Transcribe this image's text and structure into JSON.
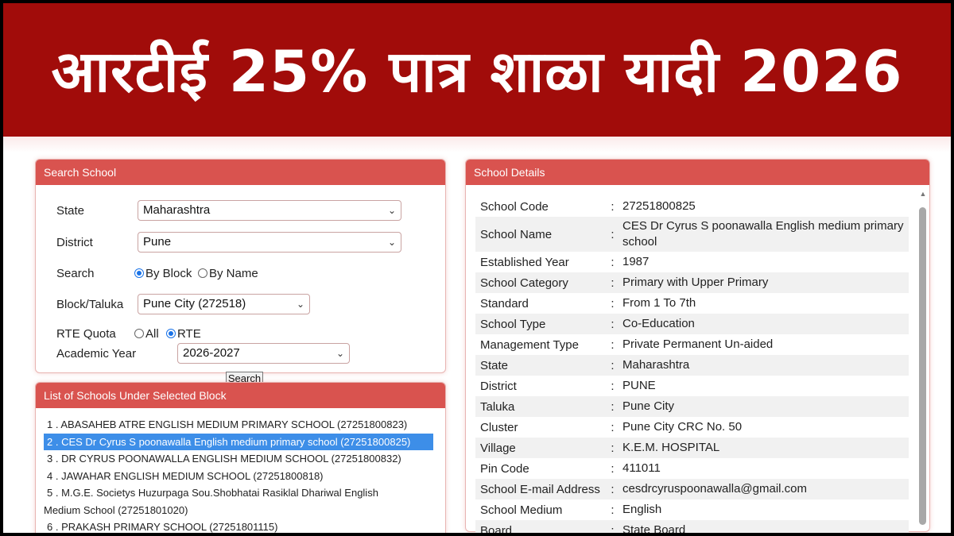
{
  "banner": {
    "title": "आरटीई 25% पात्र शाळा यादी 2026"
  },
  "search_panel": {
    "header": "Search School",
    "state_label": "State",
    "state_value": "Maharashtra",
    "district_label": "District",
    "district_value": "Pune",
    "search_label": "Search",
    "search_by_block": "By Block",
    "search_by_name": "By Name",
    "block_label": "Block/Taluka",
    "block_value": "Pune City (272518)",
    "rte_label": "RTE Quota",
    "rte_all": "All",
    "rte_rte": "RTE",
    "year_label": "Academic Year",
    "year_value": "2026-2027",
    "search_button": "Search"
  },
  "list_panel": {
    "header": "List of Schools Under Selected Block",
    "schools": [
      "1 . ABASAHEB ATRE ENGLISH MEDIUM PRIMARY SCHOOL (27251800823)",
      "2 . CES Dr Cyrus S poonawalla English medium primary school (27251800825)",
      "3 . DR CYRUS POONAWALLA ENGLISH MEDIUM SCHOOL (27251800832)",
      "4 . JAWAHAR ENGLISH MEDIUM SCHOOL (27251800818)",
      "5 . M.G.E. Societys Huzurpaga Sou.Shobhatai Rasiklal Dhariwal English",
      "Medium School (27251801020)",
      "6 . PRAKASH PRIMARY SCHOOL (27251801115)"
    ]
  },
  "details_panel": {
    "header": "School Details",
    "rows": [
      {
        "key": "School Code",
        "value": "27251800825"
      },
      {
        "key": "School Name",
        "value": "CES Dr Cyrus S poonawalla English medium primary school"
      },
      {
        "key": "Established Year",
        "value": "1987"
      },
      {
        "key": "School Category",
        "value": "Primary with Upper Primary"
      },
      {
        "key": "Standard",
        "value": "From 1 To 7th"
      },
      {
        "key": "School Type",
        "value": "Co-Education"
      },
      {
        "key": "Management Type",
        "value": "Private Permanent Un-aided"
      },
      {
        "key": "State",
        "value": "Maharashtra"
      },
      {
        "key": "District",
        "value": "PUNE"
      },
      {
        "key": "Taluka",
        "value": "Pune City"
      },
      {
        "key": "Cluster",
        "value": "Pune City CRC No. 50"
      },
      {
        "key": "Village",
        "value": "K.E.M. HOSPITAL"
      },
      {
        "key": "Pin Code",
        "value": "411011"
      },
      {
        "key": "School E-mail Address",
        "value": "cesdrcyruspoonawalla@gmail.com"
      },
      {
        "key": "School Medium",
        "value": "English"
      },
      {
        "key": "Board",
        "value": "State Board"
      }
    ],
    "separator": ":"
  },
  "colors": {
    "banner": "#a10c0a",
    "panel_header": "#d9534f",
    "selected_row": "#3d8ee8"
  }
}
